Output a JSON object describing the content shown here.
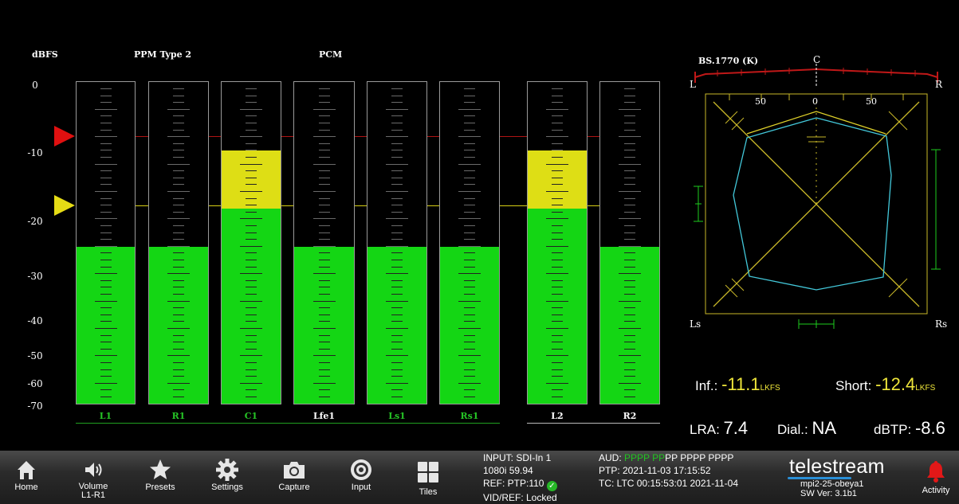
{
  "meters": {
    "scale_title": "dBFS",
    "ballistics": "PPM Type 2",
    "format": "PCM",
    "scale_labels": [
      "0",
      "-10",
      "-20",
      "-30",
      "-40",
      "-50",
      "-60",
      "-70"
    ],
    "reference_markers": {
      "red_dbfs": -8,
      "yellow_dbfs": -18,
      "red_color": "#d01010",
      "yellow_color": "#e0d715"
    },
    "channels": [
      {
        "label": "L1",
        "level_dbfs": -24.5,
        "label_color": "green"
      },
      {
        "label": "R1",
        "level_dbfs": -24.5,
        "label_color": "green"
      },
      {
        "label": "C1",
        "level_dbfs": -9.5,
        "label_color": "green"
      },
      {
        "label": "Lfe1",
        "level_dbfs": -24.5,
        "label_color": "white"
      },
      {
        "label": "Ls1",
        "level_dbfs": -24.5,
        "label_color": "green"
      },
      {
        "label": "Rs1",
        "level_dbfs": -24.5,
        "label_color": "green"
      },
      {
        "label": "L2",
        "level_dbfs": -9.5,
        "label_color": "white"
      },
      {
        "label": "R2",
        "level_dbfs": -24.5,
        "label_color": "white"
      }
    ]
  },
  "surround": {
    "title": "BS.1770 (K)",
    "top_center": "C",
    "top_left": "L",
    "top_right": "R",
    "bottom_left": "Ls",
    "bottom_right": "Rs",
    "scale_marks": [
      "50",
      "0",
      "50"
    ]
  },
  "loudness": {
    "inf_label": "Inf.:",
    "inf_value": "-11.1",
    "inf_unit": "LKFS",
    "short_label": "Short:",
    "short_value": "-12.4",
    "short_unit": "LKFS",
    "lra_label": "LRA:",
    "lra_value": "7.4",
    "dial_label": "Dial.:",
    "dial_value": "NA",
    "dbtp_label": "dBTP:",
    "dbtp_value": "-8.6"
  },
  "toolbar": {
    "buttons": [
      {
        "label": "Home",
        "icon": "home-icon"
      },
      {
        "label": "Volume",
        "sub": "L1-R1",
        "icon": "speaker-icon"
      },
      {
        "label": "Presets",
        "icon": "star-icon"
      },
      {
        "label": "Settings",
        "icon": "gear-icon"
      },
      {
        "label": "Capture",
        "icon": "camera-icon"
      },
      {
        "label": "Input",
        "icon": "target-icon"
      },
      {
        "label": "Tiles",
        "icon": "tiles-icon"
      }
    ]
  },
  "status": {
    "input": "INPUT: SDI-In 1",
    "format": "1080i 59.94",
    "ref": "REF: PTP:110",
    "vidref": "VID/REF: Locked",
    "aud_label": "AUD:",
    "aud_green": "PPPP PP",
    "aud_white": "PP PPPP PPPP",
    "ptp": "PTP: 2021-11-03 17:15:52",
    "tc": "TC: LTC 00:15:53:01 2021-11-04"
  },
  "brand": {
    "logo": "telestream",
    "device": "mpi2-25-obeya1",
    "sw_ver": "SW Ver: 3.1b1",
    "activity_label": "Activity"
  }
}
